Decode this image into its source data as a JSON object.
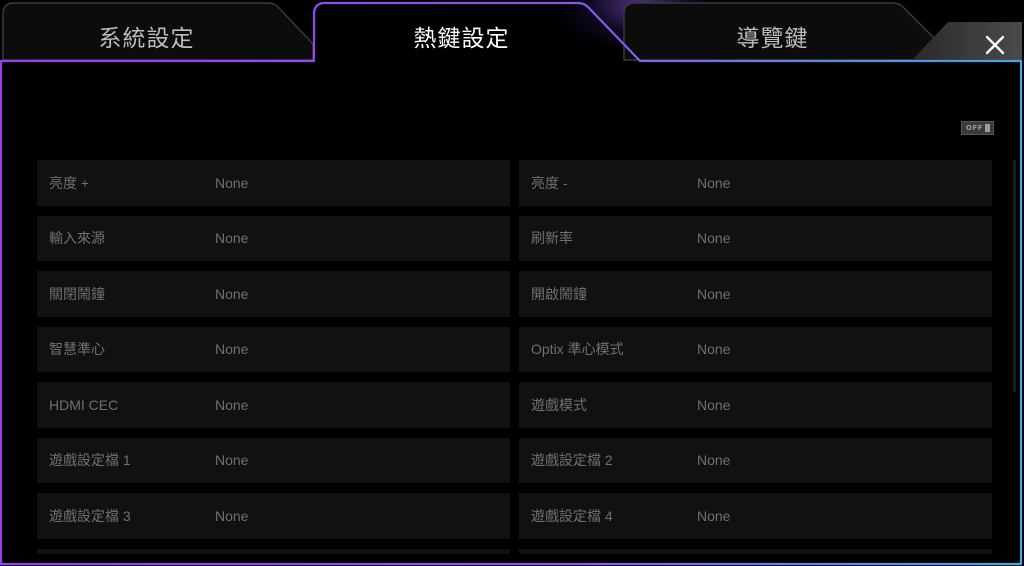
{
  "tabs": [
    {
      "label": "系統設定",
      "active": false
    },
    {
      "label": "熱鍵設定",
      "active": true
    },
    {
      "label": "導覽鍵",
      "active": false
    }
  ],
  "toggle": {
    "label": "OFF",
    "on": false
  },
  "hotkeys": [
    {
      "name": "亮度 +",
      "value": "None"
    },
    {
      "name": "亮度 -",
      "value": "None"
    },
    {
      "name": "輸入來源",
      "value": "None"
    },
    {
      "name": "刷新率",
      "value": "None"
    },
    {
      "name": "關閉鬧鐘",
      "value": "None"
    },
    {
      "name": "開啟鬧鐘",
      "value": "None"
    },
    {
      "name": "智慧準心",
      "value": "None"
    },
    {
      "name": "Optix 準心模式",
      "value": "None"
    },
    {
      "name": "HDMI CEC",
      "value": "None"
    },
    {
      "name": "遊戲模式",
      "value": "None"
    },
    {
      "name": "遊戲設定檔 1",
      "value": "None"
    },
    {
      "name": "遊戲設定檔 2",
      "value": "None"
    },
    {
      "name": "遊戲設定檔 3",
      "value": "None"
    },
    {
      "name": "遊戲設定檔 4",
      "value": "None"
    },
    {
      "name": "",
      "value": ""
    },
    {
      "name": "",
      "value": ""
    }
  ],
  "colors": {
    "frame_left": "#9b3cf0",
    "frame_right": "#3fa9e6",
    "tab_fill": "#0c0c0c",
    "row_bg": "#111111",
    "text_dim": "#707070"
  },
  "icons": {
    "close": "close-icon"
  }
}
